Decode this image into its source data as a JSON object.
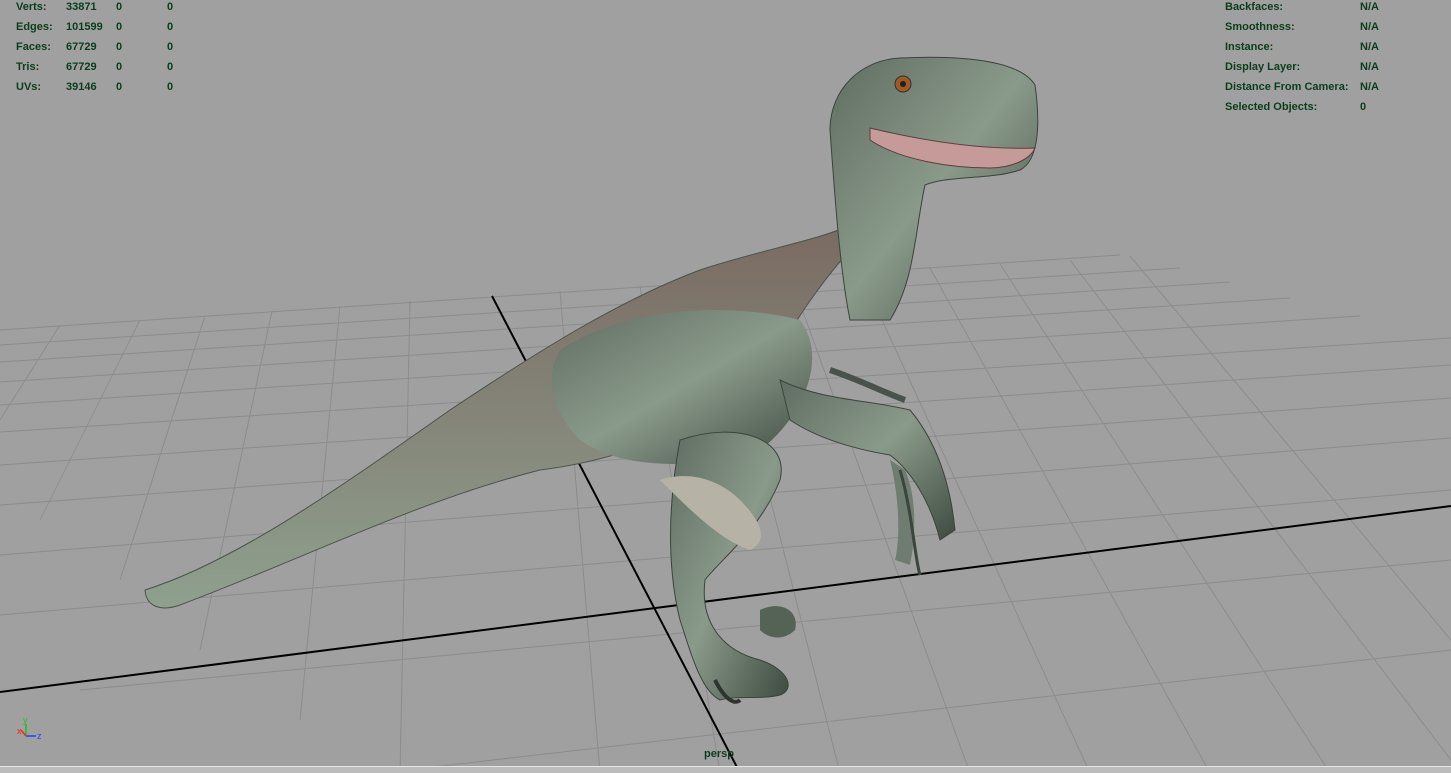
{
  "stats": {
    "rows": [
      {
        "label": "Verts:",
        "count": "33871",
        "selected": "0",
        "other": "0"
      },
      {
        "label": "Edges:",
        "count": "101599",
        "selected": "0",
        "other": "0"
      },
      {
        "label": "Faces:",
        "count": "67729",
        "selected": "0",
        "other": "0"
      },
      {
        "label": "Tris:",
        "count": "67729",
        "selected": "0",
        "other": "0"
      },
      {
        "label": "UVs:",
        "count": "39146",
        "selected": "0",
        "other": "0"
      }
    ]
  },
  "object_info": {
    "rows": [
      {
        "label": "Backfaces:",
        "value": "N/A"
      },
      {
        "label": "Smoothness:",
        "value": "N/A"
      },
      {
        "label": "Instance:",
        "value": "N/A"
      },
      {
        "label": "Display Layer:",
        "value": "N/A"
      },
      {
        "label": "Distance From Camera:",
        "value": "N/A"
      },
      {
        "label": "Selected Objects:",
        "value": "0"
      }
    ]
  },
  "camera": {
    "name": "persp"
  },
  "axes": {
    "x": "x",
    "y": "y",
    "z": "z"
  },
  "colors": {
    "background": "#a0a0a0",
    "grid": "#8a8a8a",
    "axis_line": "#000000",
    "hud_text": "#0b3d1d",
    "axis_x": "#ff2020",
    "axis_y": "#20c020",
    "axis_z": "#2040ff"
  }
}
